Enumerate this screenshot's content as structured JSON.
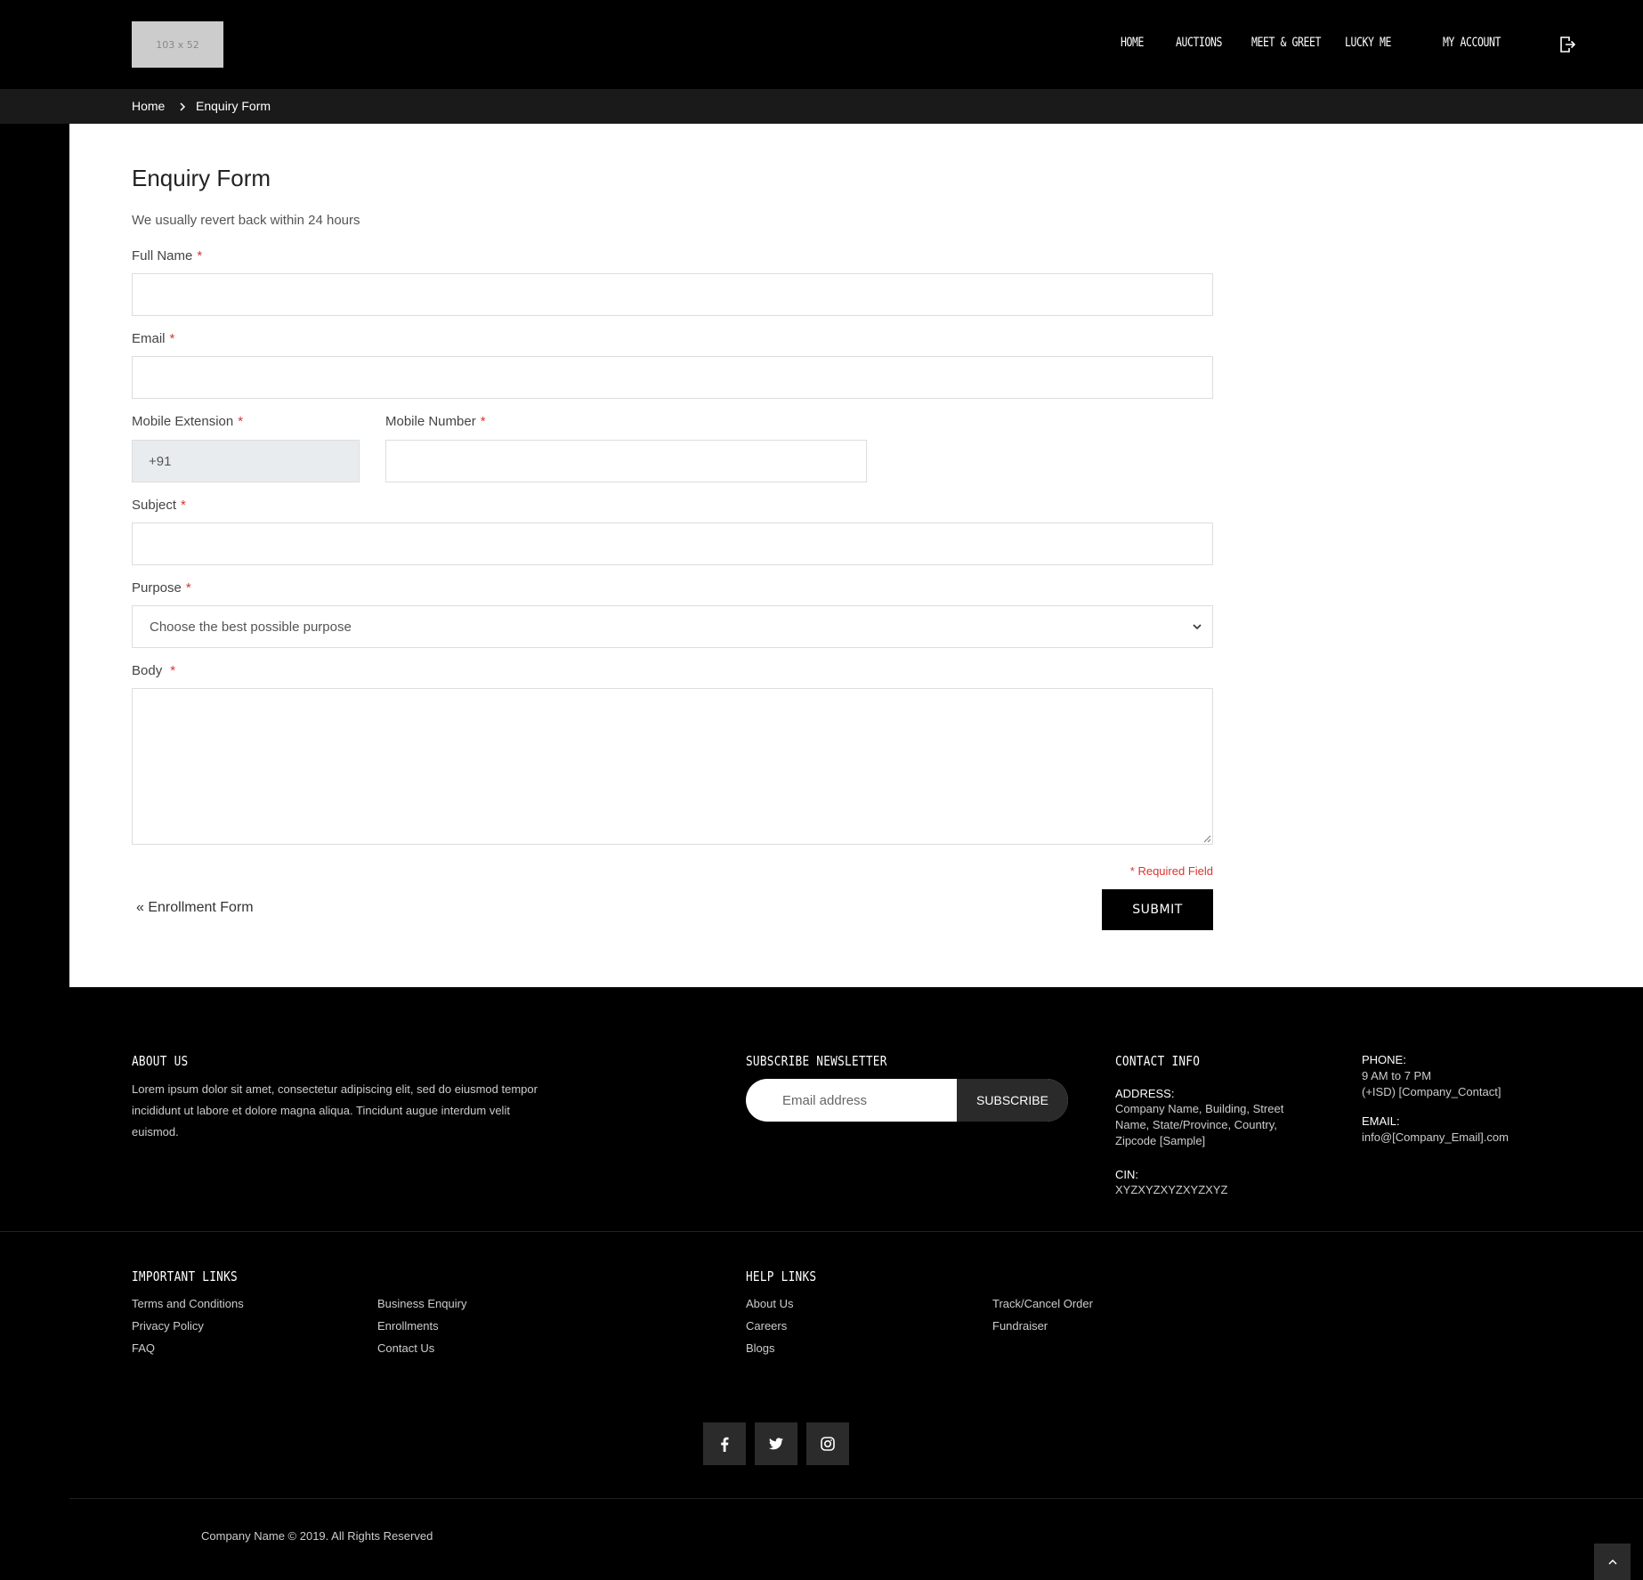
{
  "header": {
    "logo_text": "103 x 52",
    "nav": [
      {
        "label": "HOME"
      },
      {
        "label": "AUCTIONS"
      },
      {
        "label": "MEET & GREET"
      },
      {
        "label": "LUCKY ME"
      },
      {
        "label": "MY ACCOUNT"
      }
    ]
  },
  "breadcrumb": {
    "home": "Home",
    "current": "Enquiry Form"
  },
  "form": {
    "title": "Enquiry Form",
    "subtitle": "We usually revert back within 24 hours",
    "required_mark": "*",
    "full_name_label": "Full Name",
    "email_label": "Email",
    "mobile_ext_label": "Mobile Extension",
    "mobile_ext_value": "+91",
    "mobile_number_label": "Mobile Number",
    "subject_label": "Subject",
    "purpose_label": "Purpose",
    "purpose_selected": "Choose the best possible purpose",
    "body_label": "Body",
    "required_note": "* Required Field",
    "back_link": "« Enrollment Form",
    "submit": "SUBMIT"
  },
  "footer": {
    "about_title": "ABOUT US",
    "about_text": "Lorem ipsum dolor sit amet, consectetur adipiscing elit, sed do eiusmod tempor incididunt ut labore et dolore magna aliqua. Tincidunt augue interdum velit euismod.",
    "newsletter_title": "SUBSCRIBE NEWSLETTER",
    "newsletter_placeholder": "Email address",
    "newsletter_button": "SUBSCRIBE",
    "contact_title": "CONTACT INFO",
    "address_label": "ADDRESS:",
    "address_value": "Company Name, Building, Street Name, State/Province, Country, Zipcode [Sample]",
    "cin_label": "CIN:",
    "cin_value": "XYZXYZXYZXYZXYZ",
    "phone_label": "PHONE:",
    "phone_hours": "9 AM to 7 PM",
    "phone_value": "(+ISD) [Company_Contact]",
    "email_label": "EMAIL:",
    "email_value": "info@[Company_Email].com",
    "important_title": "IMPORTANT LINKS",
    "important_links": [
      "Terms and Conditions",
      "Privacy Policy",
      "FAQ",
      "Business Enquiry",
      "Enrollments",
      "Contact Us"
    ],
    "help_title": "HELP LINKS",
    "help_links": [
      "About Us",
      "Careers",
      "Blogs",
      "Track/Cancel Order",
      "Fundraiser"
    ],
    "copyright": "Company Name © 2019. All Rights Reserved"
  }
}
